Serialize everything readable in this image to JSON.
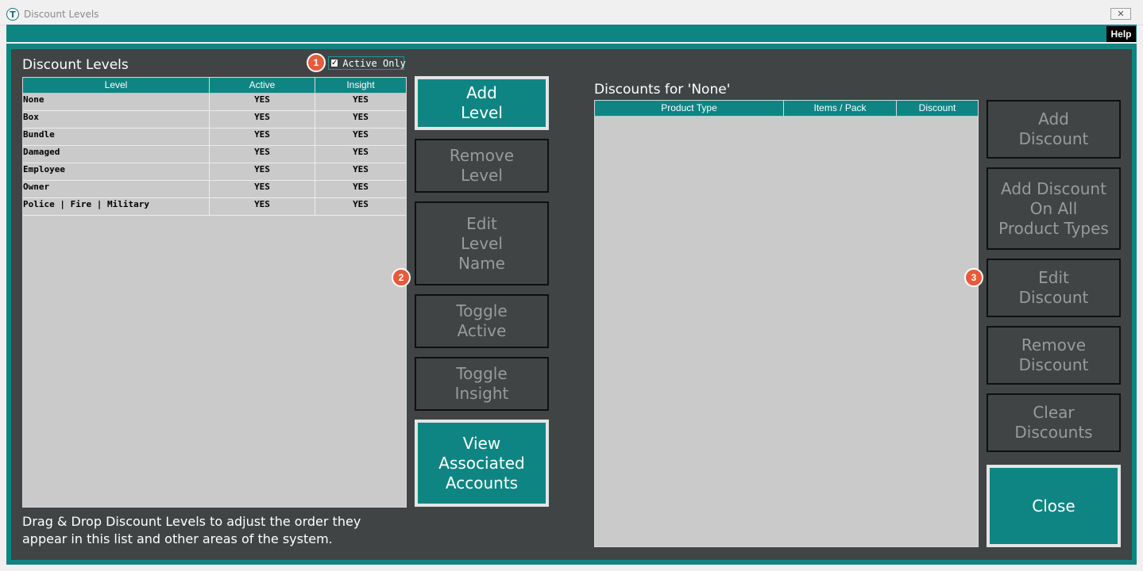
{
  "window": {
    "title": "Discount Levels",
    "app_icon": "T",
    "close_glyph": "✕"
  },
  "toolbar": {
    "help_label": "Help"
  },
  "left": {
    "heading": "Discount Levels",
    "active_only_label": "Active Only",
    "active_only_checked": true,
    "columns": [
      "Level",
      "Active",
      "Insight"
    ],
    "rows": [
      {
        "level": "None",
        "active": "YES",
        "insight": "YES"
      },
      {
        "level": "Box",
        "active": "YES",
        "insight": "YES"
      },
      {
        "level": "Bundle",
        "active": "YES",
        "insight": "YES"
      },
      {
        "level": "Damaged",
        "active": "YES",
        "insight": "YES"
      },
      {
        "level": "Employee",
        "active": "YES",
        "insight": "YES"
      },
      {
        "level": "Owner",
        "active": "YES",
        "insight": "YES"
      },
      {
        "level": "Police | Fire | Military",
        "active": "YES",
        "insight": "YES"
      }
    ],
    "footer_note": "Drag & Drop Discount Levels to adjust the order they appear in this list and other areas of the system."
  },
  "middle_buttons": {
    "add_level": "Add\nLevel",
    "remove_level": "Remove\nLevel",
    "edit_level_name": "Edit\nLevel\nName",
    "toggle_active": "Toggle\nActive",
    "toggle_insight": "Toggle\nInsight",
    "view_accounts": "View\nAssociated\nAccounts"
  },
  "right": {
    "heading": "Discounts for 'None'",
    "columns": [
      "Product Type",
      "Items / Pack",
      "Discount"
    ],
    "rows": []
  },
  "right_buttons": {
    "add_discount": "Add\nDiscount",
    "add_discount_all": "Add Discount\nOn All\nProduct Types",
    "edit_discount": "Edit\nDiscount",
    "remove_discount": "Remove\nDiscount",
    "clear_discounts": "Clear\nDiscounts",
    "close": "Close"
  },
  "markers": [
    "1",
    "2",
    "3"
  ],
  "colors": {
    "teal": "#0f8583",
    "panel": "#404444",
    "grid": "#cacaca",
    "marker": "#e85a3c"
  }
}
